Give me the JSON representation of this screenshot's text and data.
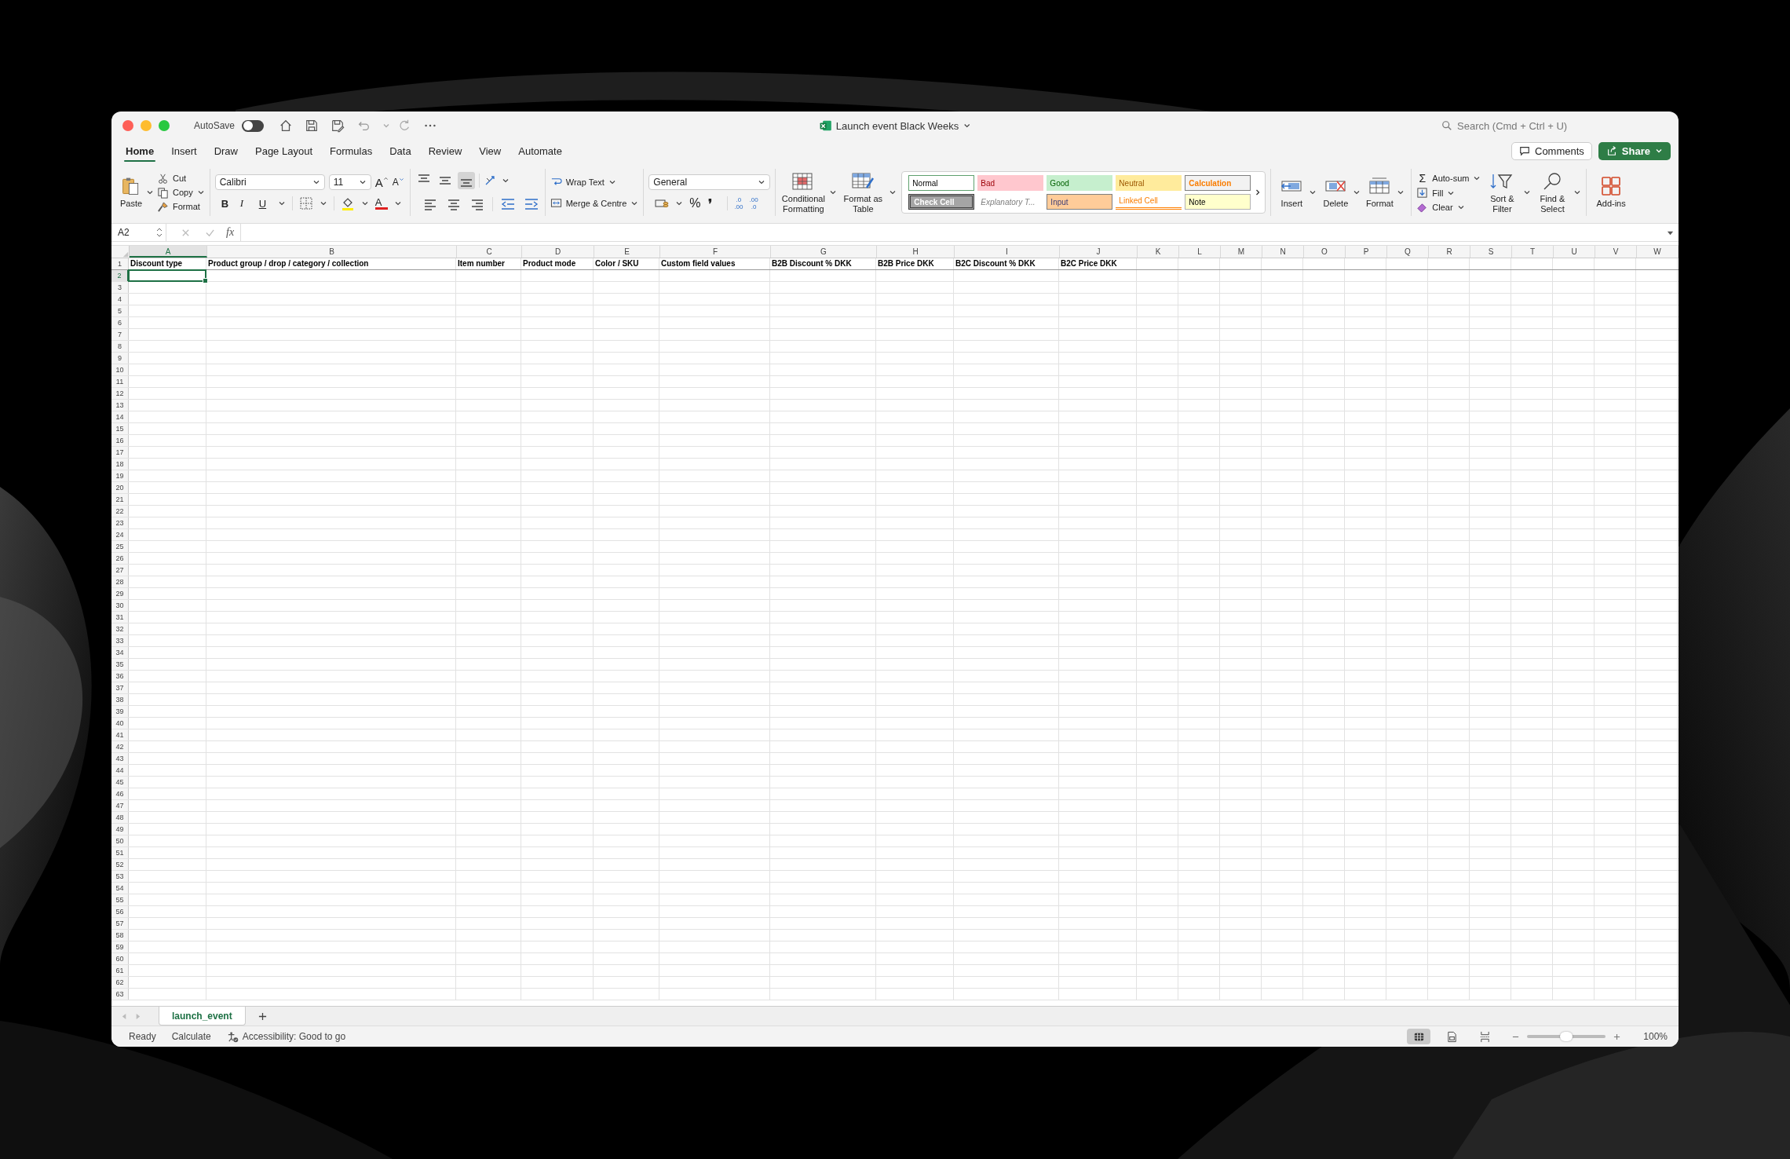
{
  "window": {
    "title": "Launch event Black Weeks"
  },
  "quick_access": {
    "autosave_label": "AutoSave",
    "autosave_on": false
  },
  "search": {
    "placeholder": "Search (Cmd + Ctrl + U)"
  },
  "tabs": [
    {
      "label": "Home",
      "selected": true
    },
    {
      "label": "Insert",
      "selected": false
    },
    {
      "label": "Draw",
      "selected": false
    },
    {
      "label": "Page Layout",
      "selected": false
    },
    {
      "label": "Formulas",
      "selected": false
    },
    {
      "label": "Data",
      "selected": false
    },
    {
      "label": "Review",
      "selected": false
    },
    {
      "label": "View",
      "selected": false
    },
    {
      "label": "Automate",
      "selected": false
    }
  ],
  "comments_button": "Comments",
  "share_button": "Share",
  "ribbon": {
    "clipboard": {
      "paste": "Paste",
      "cut": "Cut",
      "copy": "Copy",
      "format": "Format"
    },
    "font": {
      "name": "Calibri",
      "size": "11",
      "grow": "A",
      "shrink": "A",
      "bold": "B",
      "italic": "I",
      "underline": "U",
      "font_color": "A"
    },
    "align_buttons": [
      {
        "kind": "top",
        "selected": false
      },
      {
        "kind": "middle",
        "selected": false
      },
      {
        "kind": "bottom",
        "selected": true
      }
    ],
    "wrap_text": "Wrap Text",
    "merge": "Merge & Centre",
    "number": {
      "format": "General",
      "percent": "%",
      "comma": "❜",
      "decimals": [
        {
          "top": ".0",
          "bottom": ".00"
        },
        {
          "top": ".00",
          "bottom": ".0"
        }
      ]
    },
    "conditional": "Conditional Formatting",
    "format_table": "Format as Table",
    "styles": [
      {
        "label": "Normal",
        "kind": "normal"
      },
      {
        "label": "Bad",
        "kind": "bad"
      },
      {
        "label": "Good",
        "kind": "good"
      },
      {
        "label": "Neutral",
        "kind": "neutral"
      },
      {
        "label": "Calculation",
        "kind": "calculation"
      },
      {
        "label": "Check Cell",
        "kind": "check"
      },
      {
        "label": "Explanatory T...",
        "kind": "explanatory"
      },
      {
        "label": "Input",
        "kind": "input"
      },
      {
        "label": "Linked Cell",
        "kind": "linked"
      },
      {
        "label": "Note",
        "kind": "note"
      }
    ],
    "cells": [
      {
        "label": "Insert",
        "kind": "insert"
      },
      {
        "label": "Delete",
        "kind": "delete"
      },
      {
        "label": "Format",
        "kind": "format"
      }
    ],
    "editing": {
      "sigma": "Σ",
      "autosum": "Auto-sum",
      "fill": "Fill",
      "clear": "Clear",
      "sort": "Sort & Filter",
      "find": "Find & Select"
    },
    "addins": "Add-ins"
  },
  "formula_bar": {
    "name_box": "A2",
    "fx": "fx"
  },
  "sheet": {
    "columns": [
      {
        "letter": "A",
        "header": "Discount type",
        "selected": true
      },
      {
        "letter": "B",
        "header": "Product group / drop / category / collection",
        "selected": false
      },
      {
        "letter": "C",
        "header": "Item number",
        "selected": false
      },
      {
        "letter": "D",
        "header": "Product mode",
        "selected": false
      },
      {
        "letter": "E",
        "header": "Color / SKU",
        "selected": false
      },
      {
        "letter": "F",
        "header": "Custom field values",
        "selected": false
      },
      {
        "letter": "G",
        "header": "B2B Discount % DKK",
        "selected": false
      },
      {
        "letter": "H",
        "header": "B2B Price DKK",
        "selected": false
      },
      {
        "letter": "I",
        "header": "B2C Discount % DKK",
        "selected": false
      },
      {
        "letter": "J",
        "header": "B2C Price DKK",
        "selected": false
      },
      {
        "letter": "K",
        "selected": false
      },
      {
        "letter": "L",
        "selected": false
      },
      {
        "letter": "M",
        "selected": false
      },
      {
        "letter": "N",
        "selected": false
      },
      {
        "letter": "O",
        "selected": false
      },
      {
        "letter": "P",
        "selected": false
      },
      {
        "letter": "Q",
        "selected": false
      },
      {
        "letter": "R",
        "selected": false
      },
      {
        "letter": "S",
        "selected": false
      },
      {
        "letter": "T",
        "selected": false
      },
      {
        "letter": "U",
        "selected": false
      },
      {
        "letter": "V",
        "selected": false
      },
      {
        "letter": "W",
        "selected": false
      }
    ],
    "rows": [
      {
        "label": "1",
        "selected": false
      },
      {
        "label": "2",
        "selected": true
      },
      {
        "label": "3",
        "selected": false
      },
      {
        "label": "4",
        "selected": false
      },
      {
        "label": "5",
        "selected": false
      },
      {
        "label": "6",
        "selected": false
      },
      {
        "label": "7",
        "selected": false
      },
      {
        "label": "8",
        "selected": false
      },
      {
        "label": "9",
        "selected": false
      },
      {
        "label": "10",
        "selected": false
      },
      {
        "label": "11",
        "selected": false
      },
      {
        "label": "12",
        "selected": false
      },
      {
        "label": "13",
        "selected": false
      },
      {
        "label": "14",
        "selected": false
      },
      {
        "label": "15",
        "selected": false
      },
      {
        "label": "16",
        "selected": false
      },
      {
        "label": "17",
        "selected": false
      },
      {
        "label": "18",
        "selected": false
      },
      {
        "label": "19",
        "selected": false
      },
      {
        "label": "20",
        "selected": false
      },
      {
        "label": "21",
        "selected": false
      },
      {
        "label": "22",
        "selected": false
      },
      {
        "label": "23",
        "selected": false
      },
      {
        "label": "24",
        "selected": false
      },
      {
        "label": "25",
        "selected": false
      },
      {
        "label": "26",
        "selected": false
      },
      {
        "label": "27",
        "selected": false
      },
      {
        "label": "28",
        "selected": false
      },
      {
        "label": "29",
        "selected": false
      },
      {
        "label": "30",
        "selected": false
      },
      {
        "label": "31",
        "selected": false
      },
      {
        "label": "32",
        "selected": false
      },
      {
        "label": "33",
        "selected": false
      },
      {
        "label": "34",
        "selected": false
      },
      {
        "label": "35",
        "selected": false
      },
      {
        "label": "36",
        "selected": false
      },
      {
        "label": "37",
        "selected": false
      },
      {
        "label": "38",
        "selected": false
      },
      {
        "label": "39",
        "selected": false
      },
      {
        "label": "40",
        "selected": false
      },
      {
        "label": "41",
        "selected": false
      },
      {
        "label": "42",
        "selected": false
      },
      {
        "label": "43",
        "selected": false
      },
      {
        "label": "44",
        "selected": false
      },
      {
        "label": "45",
        "selected": false
      },
      {
        "label": "46",
        "selected": false
      },
      {
        "label": "47",
        "selected": false
      },
      {
        "label": "48",
        "selected": false
      },
      {
        "label": "49",
        "selected": false
      },
      {
        "label": "50",
        "selected": false
      },
      {
        "label": "51",
        "selected": false
      },
      {
        "label": "52",
        "selected": false
      },
      {
        "label": "53",
        "selected": false
      },
      {
        "label": "54",
        "selected": false
      },
      {
        "label": "55",
        "selected": false
      },
      {
        "label": "56",
        "selected": false
      },
      {
        "label": "57",
        "selected": false
      },
      {
        "label": "58",
        "selected": false
      },
      {
        "label": "59",
        "selected": false
      },
      {
        "label": "60",
        "selected": false
      },
      {
        "label": "61",
        "selected": false
      },
      {
        "label": "62",
        "selected": false
      },
      {
        "label": "63",
        "selected": false
      }
    ]
  },
  "sheet_tabs": [
    {
      "label": "launch_event",
      "selected": true
    }
  ],
  "status_bar": {
    "items": [
      "Ready",
      "Calculate"
    ],
    "accessibility": "Accessibility: Good to go",
    "views": [
      {
        "kind": "normal",
        "selected": true
      },
      {
        "kind": "page_layout",
        "selected": false
      },
      {
        "kind": "page_break",
        "selected": false
      }
    ],
    "zoom": {
      "level": 0.5,
      "reading": "100%"
    }
  }
}
